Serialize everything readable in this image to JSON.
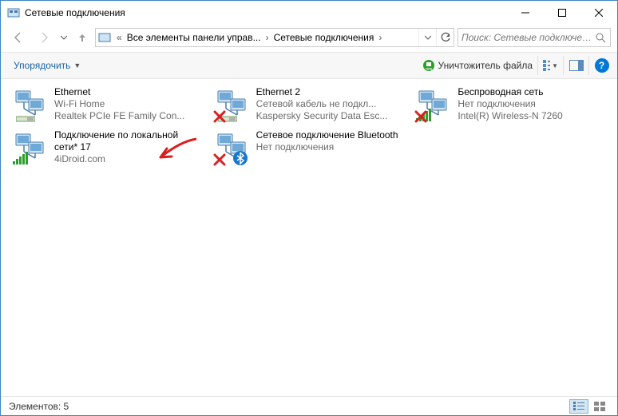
{
  "window": {
    "title": "Сетевые подключения"
  },
  "address": {
    "crumb1": "Все элементы панели управ...",
    "crumb2": "Сетевые подключения"
  },
  "search": {
    "placeholder": "Поиск: Сетевые подключения"
  },
  "toolbar": {
    "organize": "Упорядочить",
    "shredder": "Уничтожитель файла"
  },
  "items": [
    {
      "name": "Ethernet",
      "line2": "Wi-Fi Home",
      "line3": "Realtek PCIe FE Family Con...",
      "hasSignal": false,
      "hasX": false,
      "subIcon": "nic"
    },
    {
      "name": "Ethernet 2",
      "line2": "Сетевой кабель не подкл...",
      "line3": "Kaspersky Security Data Esc...",
      "hasSignal": false,
      "hasX": true,
      "subIcon": "nic"
    },
    {
      "name": "Беспроводная сеть",
      "line2": "Нет подключения",
      "line3": "Intel(R) Wireless-N 7260",
      "hasSignal": true,
      "hasX": true,
      "subIcon": "none"
    },
    {
      "name": "Подключение по локальной сети* 17",
      "line2": "",
      "line3": "4iDroid.com",
      "hasSignal": true,
      "hasX": false,
      "subIcon": "none",
      "multiline": true
    },
    {
      "name": "Сетевое подключение Bluetooth",
      "line2": "",
      "line3": "Нет подключения",
      "hasSignal": false,
      "hasX": true,
      "subIcon": "bluetooth",
      "multiline": true
    }
  ],
  "status": {
    "label": "Элементов: 5"
  }
}
